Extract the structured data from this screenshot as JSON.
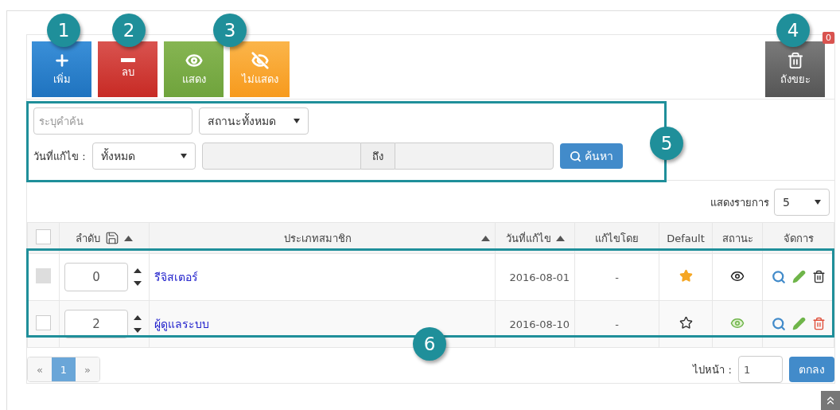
{
  "toolbar": {
    "buttons": [
      {
        "kind": "add",
        "label": "เพิ่ม"
      },
      {
        "kind": "delete",
        "label": "ลบ"
      },
      {
        "kind": "show",
        "label": "แสดง"
      },
      {
        "kind": "hide",
        "label": "ไม่แสดง"
      }
    ],
    "trash": {
      "label": "ถังขยะ",
      "count": "0"
    }
  },
  "search": {
    "keyword": {
      "placeholder": "ระบุคำค้น"
    },
    "status": {
      "value": "สถานะทั้งหมด"
    },
    "date_label": "วันที่แก้ไข :",
    "date_range": {
      "value": "ทั้งหมด"
    },
    "to_label": "ถึง",
    "button": "ค้นหา"
  },
  "page_size": {
    "label": "แสดงรายการ",
    "value": "5"
  },
  "table": {
    "columns": [
      {
        "kind": "check",
        "checked": false
      },
      {
        "kind": "order",
        "label": "ลำดับ",
        "sortable": true
      },
      {
        "kind": "text",
        "label": "ประเภทสมาชิก",
        "sortable": true
      },
      {
        "kind": "text",
        "label": "วันที่แก้ไข",
        "sortable": true
      },
      {
        "kind": "text",
        "label": "แก้ไขโดย",
        "sortable": false
      },
      {
        "kind": "text",
        "label": "Default",
        "sortable": false
      },
      {
        "kind": "text",
        "label": "สถานะ",
        "sortable": false
      },
      {
        "kind": "text",
        "label": "จัดการ",
        "sortable": false
      }
    ],
    "rows": [
      {
        "checkbox_disabled": true,
        "order": "0",
        "name": "รีจิสเตอร์",
        "date": "2016-08-01",
        "edited_by": "-",
        "default": true,
        "visible": false,
        "deletable": false
      },
      {
        "checkbox_disabled": false,
        "order": "2",
        "name": "ผู้ดูแลระบบ",
        "date": "2016-08-10",
        "edited_by": "-",
        "default": false,
        "visible": true,
        "deletable": true
      }
    ]
  },
  "pagination": {
    "prev": "«",
    "pages": [
      {
        "label": "1",
        "selected": true
      }
    ],
    "next": "»",
    "goto_label": "ไปหน้า :",
    "goto_value": "1",
    "goto_button": "ตกลง"
  },
  "callouts": [
    {
      "number": "1"
    },
    {
      "number": "2"
    },
    {
      "number": "3"
    },
    {
      "number": "4"
    },
    {
      "number": "5"
    },
    {
      "number": "6"
    }
  ]
}
